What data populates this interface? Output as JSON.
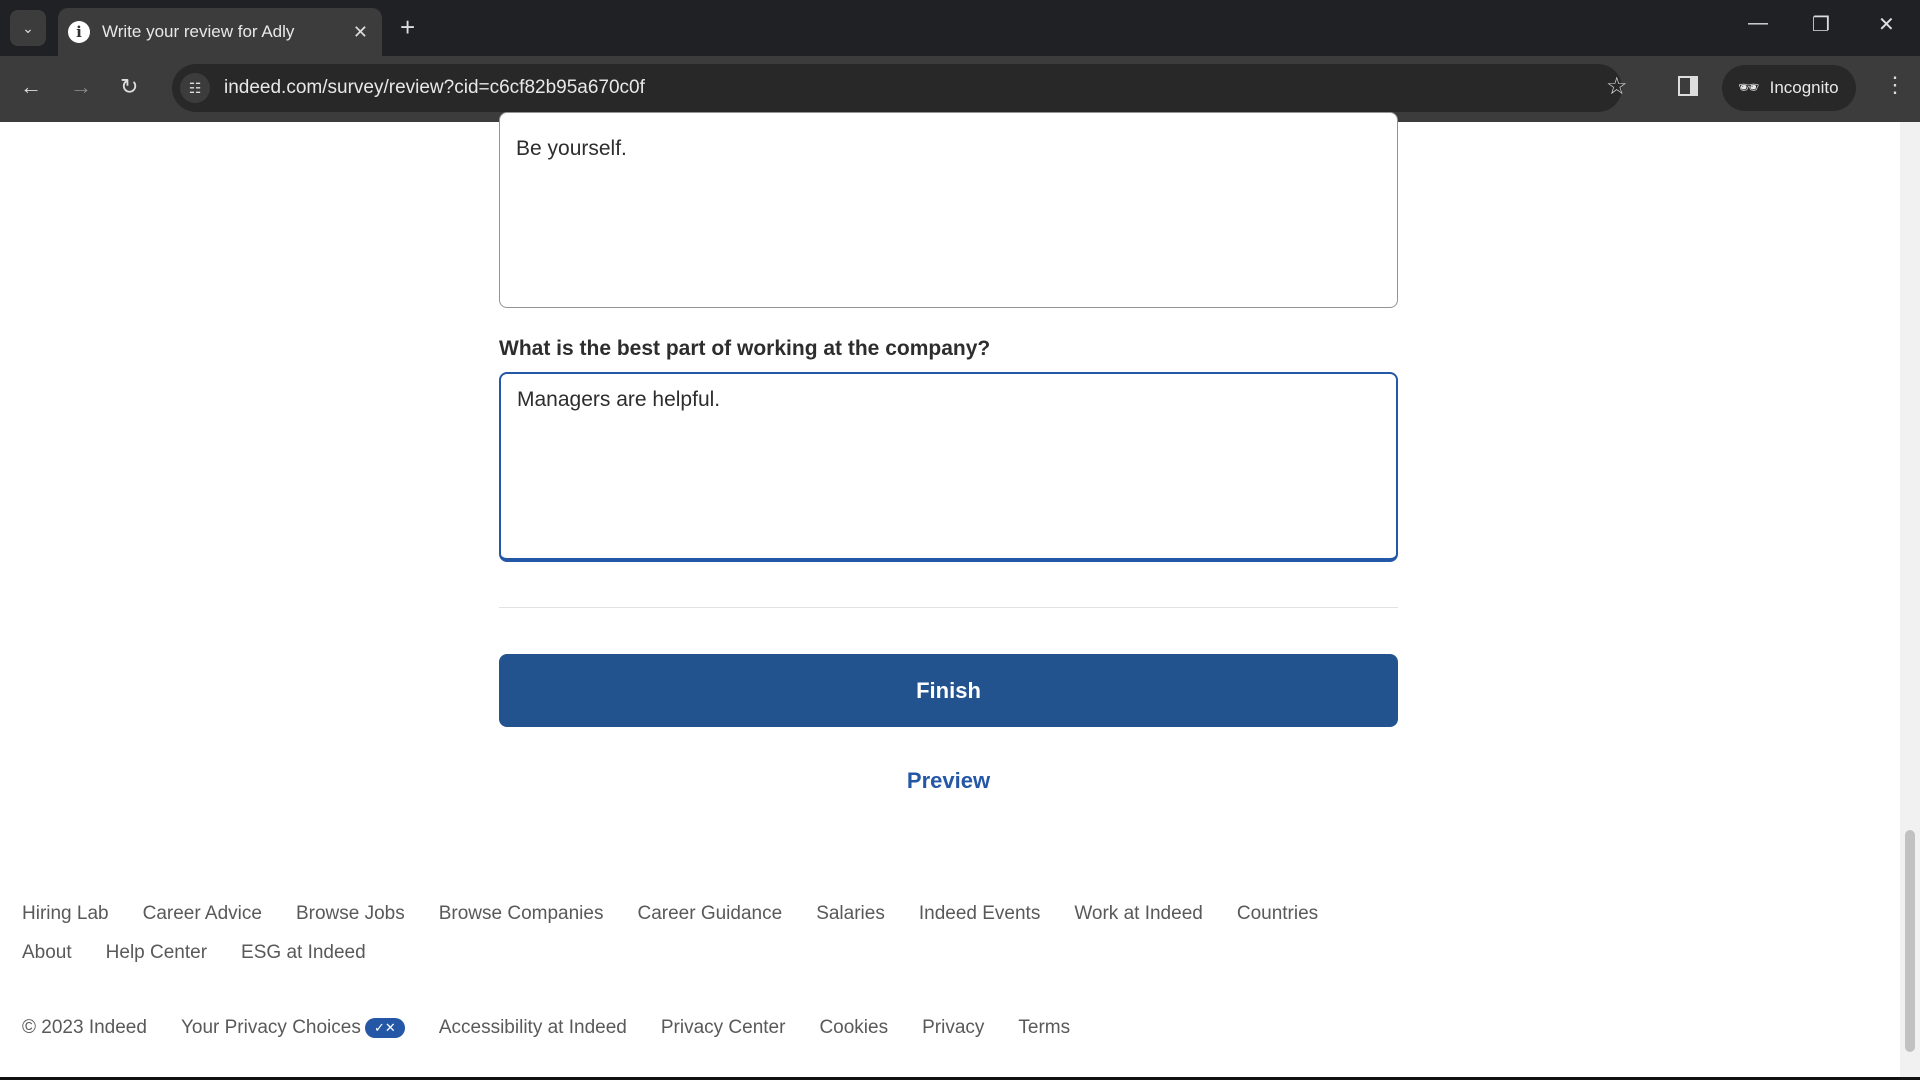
{
  "browser": {
    "tab_title": "Write your review for Adly",
    "url": "indeed.com/survey/review?cid=c6cf82b95a670c0f",
    "incognito_label": "Incognito"
  },
  "form": {
    "previous_answer": "Be yourself.",
    "question": "What is the best part of working at the company?",
    "answer": "Managers are helpful.",
    "finish_label": "Finish",
    "preview_label": "Preview"
  },
  "footer": {
    "links_row1": [
      "Hiring Lab",
      "Career Advice",
      "Browse Jobs",
      "Browse Companies",
      "Career Guidance",
      "Salaries",
      "Indeed Events",
      "Work at Indeed",
      "Countries"
    ],
    "links_row2": [
      "About",
      "Help Center",
      "ESG at Indeed"
    ],
    "copyright": "© 2023 Indeed",
    "legal": [
      "Your Privacy Choices",
      "Accessibility at Indeed",
      "Privacy Center",
      "Cookies",
      "Privacy",
      "Terms"
    ]
  },
  "colors": {
    "primary": "#23538f",
    "link": "#2557a7"
  }
}
